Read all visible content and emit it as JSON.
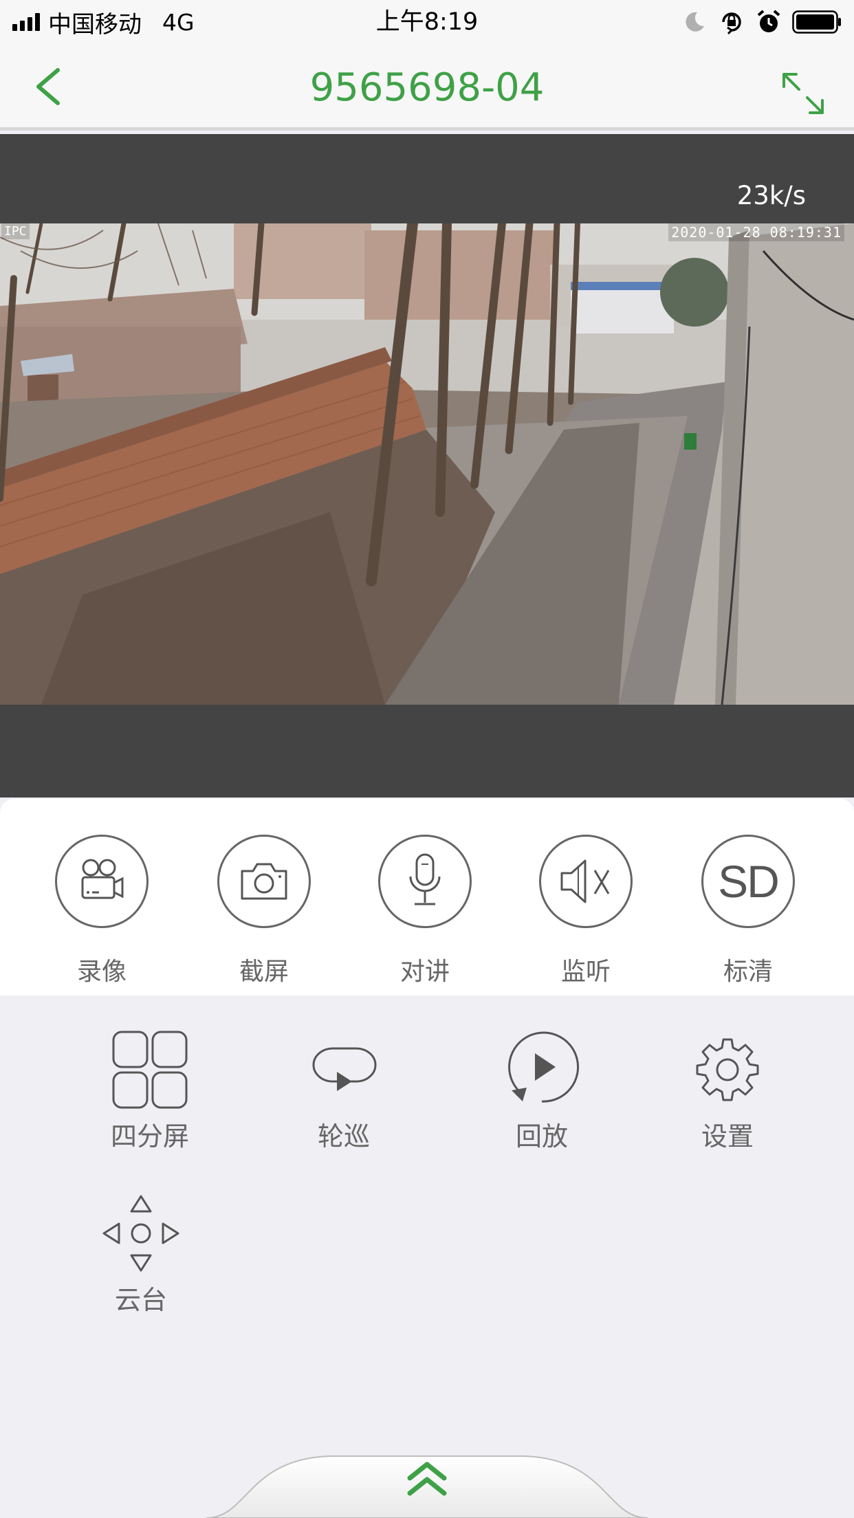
{
  "status_bar": {
    "carrier": "中国移动",
    "network": "4G",
    "time": "上午8:19"
  },
  "nav": {
    "title": "9565698-04"
  },
  "video": {
    "speed": "23k/s",
    "timestamp": "2020-01-28 08:19:31",
    "channel_label": "IPC"
  },
  "controls": [
    {
      "label": "录像",
      "icon": "video-camera-icon"
    },
    {
      "label": "截屏",
      "icon": "camera-icon"
    },
    {
      "label": "对讲",
      "icon": "microphone-icon"
    },
    {
      "label": "监听",
      "icon": "speaker-mute-icon"
    },
    {
      "label": "标清",
      "icon": "sd-text-icon",
      "icon_text": "SD"
    }
  ],
  "functions": [
    {
      "label": "四分屏",
      "icon": "quad-screen-icon"
    },
    {
      "label": "轮巡",
      "icon": "cycle-icon"
    },
    {
      "label": "回放",
      "icon": "playback-icon"
    },
    {
      "label": "设置",
      "icon": "gear-icon"
    },
    {
      "label": "云台",
      "icon": "ptz-direction-icon"
    }
  ],
  "colors": {
    "accent": "#3fa147",
    "video_bg": "#444444",
    "panel_bg": "#efeff4"
  }
}
